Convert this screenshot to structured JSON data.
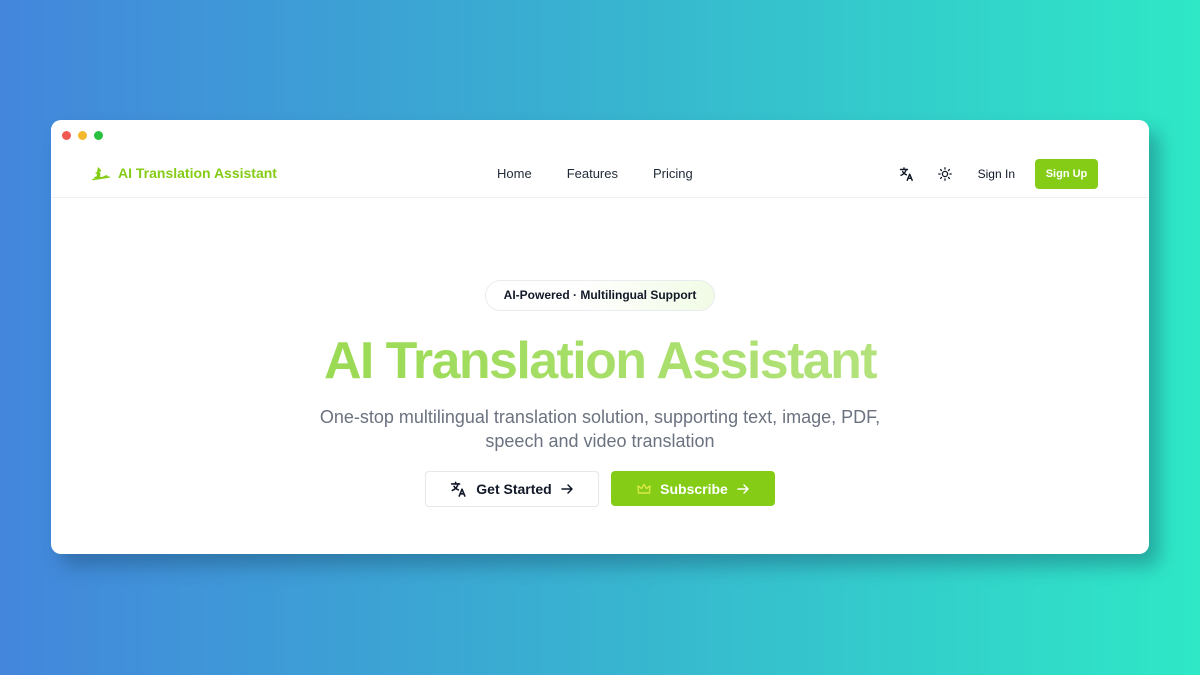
{
  "brand": {
    "name": "AI Translation Assistant",
    "logo_icon": "hat-logo-icon",
    "accent": "#84cc16"
  },
  "nav": {
    "links": [
      "Home",
      "Features",
      "Pricing"
    ]
  },
  "header_actions": {
    "translate_icon": "translate-icon",
    "theme_icon": "sun-icon",
    "signin_label": "Sign In",
    "signup_label": "Sign Up"
  },
  "hero": {
    "badge": "AI-Powered · Multilingual Support",
    "title": "AI Translation Assistant",
    "subtitle": "One-stop multilingual translation solution, supporting text, image, PDF, speech and video translation",
    "primary_cta": "Get Started",
    "secondary_cta": "Subscribe"
  },
  "colors": {
    "accent": "#84cc16",
    "background_start": "#4386dc",
    "background_end": "#2ee8c6",
    "subtitle": "#6b7280"
  }
}
